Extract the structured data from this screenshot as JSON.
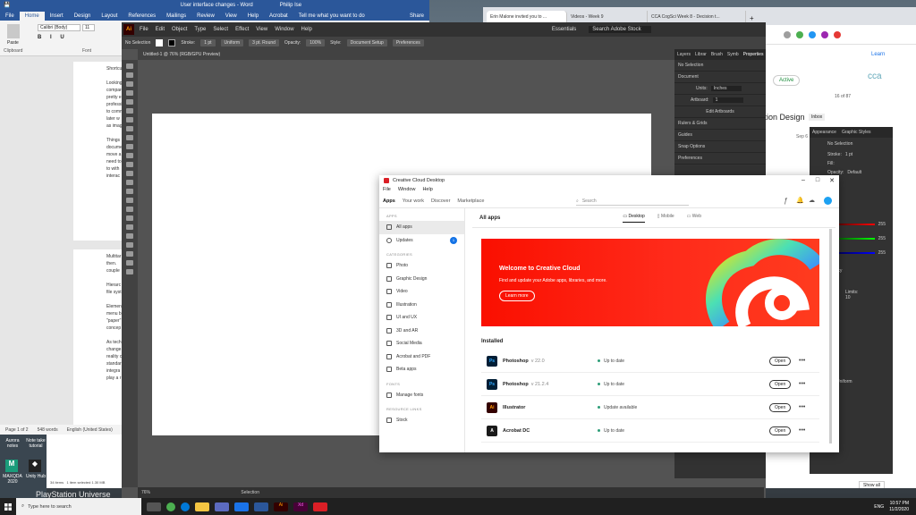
{
  "word": {
    "title": "User interface changes - Word",
    "user": "Philip Ise",
    "tabs": [
      "File",
      "Home",
      "Insert",
      "Design",
      "Layout",
      "References",
      "Mailings",
      "Review",
      "View",
      "Help",
      "Acrobat"
    ],
    "tell_me": "Tell me what you want to do",
    "share": "Share",
    "font": "Calibri (Body)",
    "font_size": "11",
    "groups": {
      "clipboard": "Clipboard",
      "font": "Font",
      "paste": "Paste"
    },
    "page1_lines": [
      "Shortcu",
      "",
      "Looking",
      "compare",
      "pretty e",
      "professi",
      "to comm",
      "later w",
      "as imag",
      "",
      "Things",
      "docume",
      "move a",
      "need to",
      "to with",
      "interac"
    ],
    "page2_lines": [
      "Multitar",
      "then.",
      "couple",
      "",
      "Hierarc",
      "file syst",
      "",
      "Elemen",
      "menu b",
      "\"paper\"",
      "concep",
      "",
      "As tech",
      "change",
      "reality c",
      "standar",
      "integra",
      "play a r"
    ],
    "status": {
      "page": "Page 1 of 2",
      "words": "548 words",
      "lang": "English (United States)"
    }
  },
  "illustrator": {
    "logo": "Ai",
    "menus": [
      "File",
      "Edit",
      "Object",
      "Type",
      "Select",
      "Effect",
      "View",
      "Window",
      "Help"
    ],
    "workspace": "Essentials",
    "search_placeholder": "Search Adobe Stock",
    "ctrl": {
      "selection": "No Selection",
      "stroke": "Stroke:",
      "stroke_val": "1 pt",
      "uniform": "Uniform",
      "round": "3 pt. Round",
      "opacity": "Opacity:",
      "opacity_val": "100%",
      "style": "Style:",
      "doc_setup": "Document Setup",
      "prefs": "Preferences"
    },
    "doc_tab": "Untitled-1 @ 76% (RGB/GPU Preview)",
    "panel_tabs": [
      "Layers",
      "Librar",
      "Brush",
      "Symb",
      "Properties"
    ],
    "panel": {
      "no_sel": "No Selection",
      "document": "Document",
      "units_label": "Units:",
      "units": "Inches",
      "artboard_label": "Artboard:",
      "artboard": "1",
      "edit_artboards": "Edit Artboards",
      "rulers": "Rulers & Grids",
      "guides": "Guides",
      "snap": "Snap Options",
      "preferences": "Preferences"
    },
    "zoom": "76%",
    "status_tool": "Selection"
  },
  "chrome": {
    "tabs": [
      "Erin Malone invited you to ...",
      "Videos - Week 9",
      "CCA CogSci Week 8 - Decision t..."
    ],
    "active_tab": 0,
    "status": "Active",
    "page_count": "16 of 87",
    "page_title": "ction Design",
    "inbox": "Inbox",
    "learn": "Learn",
    "brand": "cca",
    "date": "Sep 6"
  },
  "illustrator_right": {
    "tabs": [
      "Appearance",
      "Graphic Styles"
    ],
    "no_sel": "No Selection",
    "stroke": "Stroke:",
    "stroke_val": "1 pt",
    "fill": "Fill:",
    "opacity": "Opacity:",
    "opacity_val": "Default",
    "transparency": "Transparency",
    "limits": "Limits: 10",
    "uniform": "Uniform",
    "slider_vals": [
      "255",
      "255",
      "255"
    ]
  },
  "cc": {
    "title": "Creative Cloud Desktop",
    "menu": [
      "File",
      "Window",
      "Help"
    ],
    "nav": [
      "Apps",
      "Your work",
      "Discover",
      "Marketplace"
    ],
    "search_placeholder": "Search",
    "sidebar": {
      "apps_heading": "APPS",
      "all_apps": "All apps",
      "updates": "Updates",
      "updates_count": "1",
      "categories_heading": "CATEGORIES",
      "categories": [
        "Photo",
        "Graphic Design",
        "Video",
        "Illustration",
        "UI and UX",
        "3D and AR",
        "Social Media",
        "Acrobat and PDF",
        "Beta apps"
      ],
      "fonts_heading": "FONTS",
      "manage_fonts": "Manage fonts",
      "resource_heading": "RESOURCE LINKS",
      "stock": "Stock"
    },
    "main": {
      "title": "All apps",
      "devices": [
        "Desktop",
        "Mobile",
        "Web"
      ],
      "banner_title": "Welcome to Creative Cloud",
      "banner_text": "Find and update your Adobe apps, libraries, and more.",
      "banner_button": "Learn more",
      "installed": "Installed",
      "apps": [
        {
          "icon": "Ps",
          "name": "Photoshop",
          "version": "v 22.0",
          "status": "Up to date",
          "action": "Open",
          "color": "#001e36",
          "fg": "#31a8ff"
        },
        {
          "icon": "Ps",
          "name": "Photoshop",
          "version": "v 21.2.4",
          "status": "Up to date",
          "action": "Open",
          "color": "#001e36",
          "fg": "#31a8ff"
        },
        {
          "icon": "Ai",
          "name": "Illustrator",
          "version": "",
          "status": "Update available",
          "action": "Open",
          "color": "#330000",
          "fg": "#ff9a00"
        },
        {
          "icon": "A",
          "name": "Acrobat DC",
          "version": "",
          "status": "Up to date",
          "action": "Open",
          "color": "#1a1a1a",
          "fg": "#ffffff"
        }
      ]
    }
  },
  "desktop": {
    "icons": [
      "Aurora notes",
      "Note take tutorial",
      "MAXQDA 2020",
      "Unity Hub"
    ],
    "explorer_status": [
      "34 items",
      "1 item selected 1.30 MB"
    ],
    "wallpaper_text": "PlayStation Universe",
    "show_all": "Show all"
  },
  "taskbar": {
    "search": "Type here to search",
    "time": "10:57 PM",
    "date": "11/2/2020",
    "lang": "ENG"
  },
  "colors": {
    "word_blue": "#2b579a",
    "ai_dark": "#323232",
    "cc_red": "#fa0f00",
    "accent_blue": "#1473e6"
  }
}
